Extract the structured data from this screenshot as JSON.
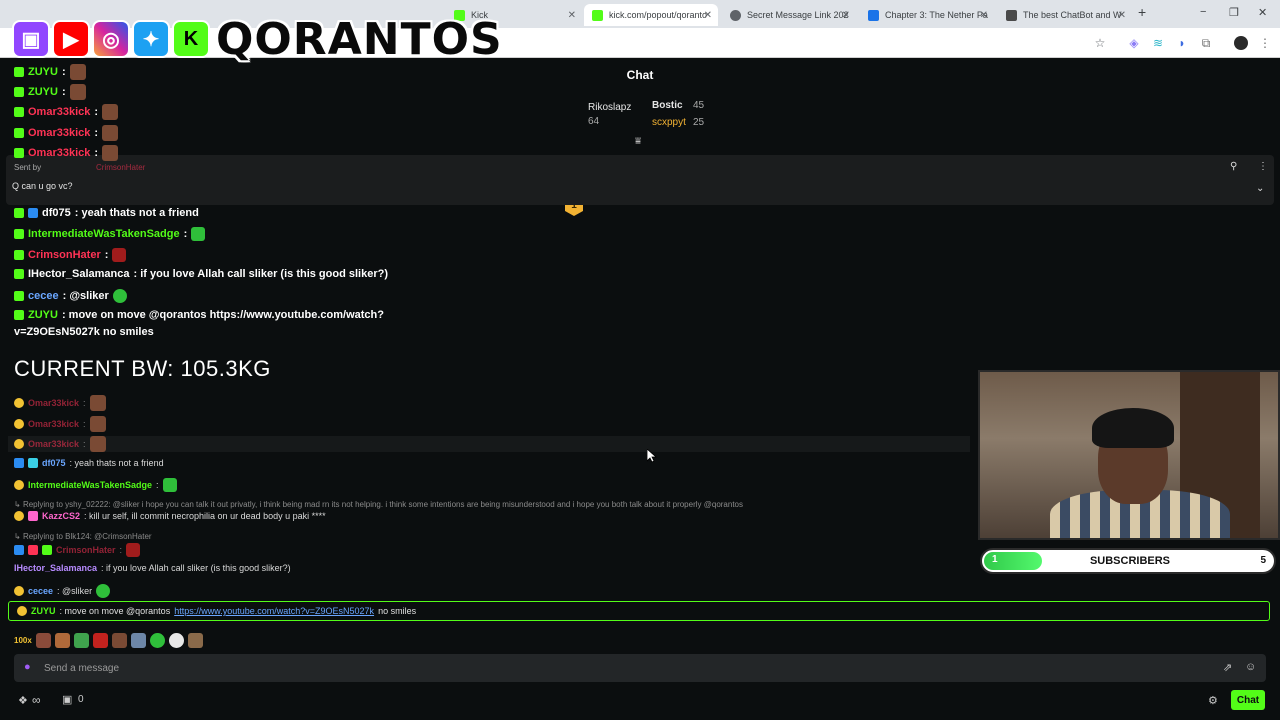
{
  "browser": {
    "tabs": [
      {
        "label": "Kick",
        "active": false,
        "color": "#53fc18"
      },
      {
        "label": "kick.com/popout/qoranto",
        "active": true,
        "color": "#53fc18"
      },
      {
        "label": "Secret Message Link 202",
        "active": false,
        "color": "#5f6368"
      },
      {
        "label": "Chapter 3: The Nether Pa",
        "active": false,
        "color": "#1a73e8"
      },
      {
        "label": "The best ChatBot and W",
        "active": false,
        "color": "#4a4a4a"
      }
    ],
    "new_tab": "+",
    "window_controls": {
      "minimize": "−",
      "restore": "❐",
      "close": "✕"
    }
  },
  "overlay": {
    "logo_text": "QORANTOS",
    "social_letters": {
      "kick": "K"
    },
    "bodyweight": "CURRENT BW: 105.3KG",
    "subs": {
      "label": "SUBSCRIBERS",
      "current": "1",
      "goal": "5",
      "progress": 0.2
    }
  },
  "chat": {
    "title": "Chat",
    "gifters": [
      {
        "name": "Rikoslapz",
        "value": "64"
      },
      {
        "name": "Bostic",
        "value": "45"
      },
      {
        "name": "scxppyt",
        "value": "25"
      }
    ],
    "rank": "1",
    "pinned": {
      "sent_by": "Sent by",
      "user": "CrimsonHater",
      "text": "Q can u go vc?"
    },
    "overlay_messages": [
      {
        "user": "ZUYU",
        "color": "#53fc18",
        "text": ":"
      },
      {
        "user": "ZUYU",
        "color": "#53fc18",
        "text": ":"
      },
      {
        "user": "Omar33kick",
        "color": "#ff3355",
        "text": ":"
      },
      {
        "user": "Omar33kick",
        "color": "#ff3355",
        "text": ":"
      },
      {
        "user": "Omar33kick",
        "color": "#ff3355",
        "text": ":"
      },
      {
        "user": "df075",
        "color": "#ffffff",
        "text": ": yeah thats not a friend"
      },
      {
        "user": "IntermediateWasTakenSadge",
        "color": "#53fc18",
        "text": ":"
      },
      {
        "user": "CrimsonHater",
        "color": "#ff3355",
        "text": ":"
      },
      {
        "user": "IHector_Salamanca",
        "color": "#ffffff",
        "text": ": if you love Allah call sliker (is this good sliker?)"
      },
      {
        "user": "cecee",
        "color": "#6aa6ff",
        "text": ": @sliker"
      },
      {
        "user": "ZUYU",
        "color": "#53fc18",
        "text": ": move on move @qorantos https://www.youtube.com/watch?"
      },
      {
        "user": "",
        "color": "#ffffff",
        "text": "v=Z9OEsN5027k no smiles"
      }
    ],
    "messages": [
      {
        "user": "Omar33kick",
        "color": "#ff3355",
        "text": ":"
      },
      {
        "user": "Omar33kick",
        "color": "#ff3355",
        "text": ":"
      },
      {
        "user": "Omar33kick",
        "color": "#ff3355",
        "text": ":"
      },
      {
        "user": "df075",
        "color": "#6aa6ff",
        "text": ": yeah thats not a friend"
      },
      {
        "user": "IntermediateWasTakenSadge",
        "color": "#53fc18",
        "text": ":"
      },
      {
        "reply": "Replying to yshy_02222: @sliker i hope you can talk it out privatly, i think being mad rn its not helping. i think some intentions are being misunderstood and i hope you both talk about it properly @qorantos"
      },
      {
        "user": "KazzCS2",
        "color": "#ff66cc",
        "text": ": kill ur self, ill commit necrophilia on ur dead body u paki ****"
      },
      {
        "reply": "Replying to Blk124: @CrimsonHater"
      },
      {
        "user": "CrimsonHater",
        "color": "#ff3355",
        "text": ":"
      },
      {
        "user": "IHector_Salamanca",
        "color": "#b78bff",
        "text": ": if you love Allah call sliker (is this good sliker?)"
      },
      {
        "user": "cecee",
        "color": "#6aa6ff",
        "text": ": @sliker"
      }
    ],
    "highlight": {
      "user": "ZUYU",
      "prefix": ": move on move @qorantos",
      "link": "https://www.youtube.com/watch?v=Z9OEsN5027k",
      "suffix": "no smiles"
    },
    "emote_count": "100x",
    "input_placeholder": "Send a message",
    "viewer_icon": "∞",
    "gift_count": "0",
    "send_label": "Chat"
  }
}
